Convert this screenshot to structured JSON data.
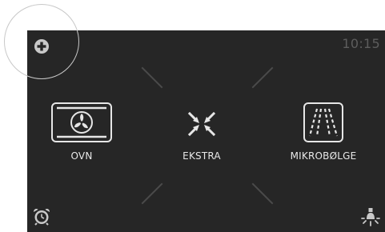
{
  "header": {
    "add_icon": "plus-circle-icon",
    "clock": "10:15"
  },
  "modes": [
    {
      "label": "OVN",
      "icon": "fan-oven-icon"
    },
    {
      "label": "EKSTRA",
      "icon": "expand-arrows-icon"
    },
    {
      "label": "MIKROBØLGE",
      "icon": "microwave-waves-icon"
    }
  ],
  "footer": {
    "left_icon": "alarm-clock-icon",
    "right_icon": "light-bulb-icon"
  },
  "colors": {
    "screen_bg": "#262626",
    "icon_primary": "#e6e6e6",
    "muted": "#5d5d5d"
  }
}
